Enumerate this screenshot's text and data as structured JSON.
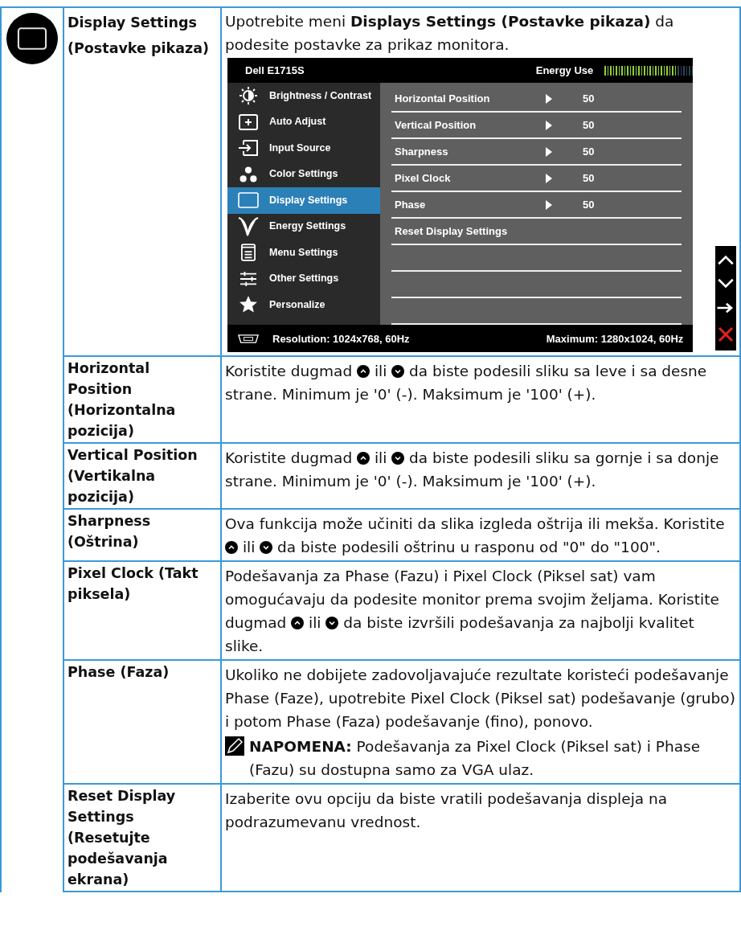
{
  "section": {
    "title": "Display Settings (Postavke pikaza)",
    "intro": "Upotrebite meni **Displays Settings (Postavke pikaza)** da podesite postavke za prikaz monitora."
  },
  "osd": {
    "model": "Dell E1715S",
    "energy_label": "Energy Use",
    "energy": {
      "level": 0.8
    },
    "menu": [
      {
        "kind": "brightness",
        "label": "Brightness / Contrast",
        "selected": false
      },
      {
        "kind": "auto",
        "label": "Auto Adjust",
        "selected": false
      },
      {
        "kind": "input",
        "label": "Input Source",
        "selected": false
      },
      {
        "kind": "color",
        "label": "Color Settings",
        "selected": false
      },
      {
        "kind": "display",
        "label": "Display Settings",
        "selected": true
      },
      {
        "kind": "energy",
        "label": "Energy Settings",
        "selected": false
      },
      {
        "kind": "menu",
        "label": "Menu Settings",
        "selected": false
      },
      {
        "kind": "other",
        "label": "Other Settings",
        "selected": false
      },
      {
        "kind": "personalize",
        "label": "Personalize",
        "selected": false
      }
    ],
    "submenu": [
      {
        "label": "Horizontal Position",
        "value": "50"
      },
      {
        "label": "Vertical Position",
        "value": "50"
      },
      {
        "label": "Sharpness",
        "value": "50"
      },
      {
        "label": "Pixel Clock",
        "value": "50"
      },
      {
        "label": "Phase",
        "value": "50"
      },
      {
        "label": "Reset Display Settings"
      }
    ],
    "resolution": "Resolution: 1024x768, 60Hz",
    "maximum": "Maximum: 1280x1024, 60Hz",
    "buttons": [
      {
        "kind": "up"
      },
      {
        "kind": "down"
      },
      {
        "kind": "enter"
      },
      {
        "kind": "exit"
      }
    ]
  },
  "rows": [
    {
      "label": "Horizontal Position (Horizontalna pozicija)",
      "parts": [
        {
          "kind": "text",
          "text": "Koristite dugmad "
        },
        {
          "kind": "up"
        },
        {
          "kind": "text",
          "text": " ili "
        },
        {
          "kind": "down"
        },
        {
          "kind": "text",
          "text": " da biste podesili sliku sa leve i sa desne strane. Minimum je '0' (-). Maksimum je '100' (+)."
        }
      ]
    },
    {
      "label": "Vertical Position (Vertikalna pozicija)",
      "parts": [
        {
          "kind": "text",
          "text": "Koristite dugmad "
        },
        {
          "kind": "up"
        },
        {
          "kind": "text",
          "text": " ili "
        },
        {
          "kind": "down"
        },
        {
          "kind": "text",
          "text": " da biste podesili sliku sa gornje i sa donje strane. Minimum je '0' (-). Maksimum je '100' (+)."
        }
      ]
    },
    {
      "label": "Sharpness (Oštrina)",
      "parts": [
        {
          "kind": "text",
          "text": "Ova funkcija može učiniti da slika izgleda oštrija ili mekša. Koristite "
        },
        {
          "kind": "up"
        },
        {
          "kind": "text",
          "text": " ili "
        },
        {
          "kind": "down"
        },
        {
          "kind": "text",
          "text": " da biste podesili oštrinu u rasponu od \"0\" do \"100\"."
        }
      ]
    },
    {
      "label": "Pixel Clock (Takt piksela)",
      "parts": [
        {
          "kind": "text",
          "text": "Podešavanja za Phase (Fazu) i Pixel Clock (Piksel sat) vam omogućavaju da podesite monitor prema svojim željama. Koristite dugmad "
        },
        {
          "kind": "up"
        },
        {
          "kind": "text",
          "text": " ili "
        },
        {
          "kind": "down"
        },
        {
          "kind": "text",
          "text": " da biste izvršili podešavanja za najbolji kvalitet slike."
        }
      ]
    },
    {
      "label": "Phase (Faza)",
      "parts": [
        {
          "kind": "text",
          "text": "Ukoliko ne dobijete zadovoljavajuće rezultate koristeći podešavanje Phase (Faze), upotrebite Pixel Clock (Piksel sat) podešavanje (grubo) i potom Phase (Faza) podešavanje (fino), ponovo."
        }
      ],
      "note": "**NAPOMENA:** Podešavanja za Pixel Clock (Piksel sat) i Phase (Fazu) su dostupna samo za VGA ulaz."
    },
    {
      "label": "Reset Display Settings (Resetujte podešavanja ekrana)",
      "parts": [
        {
          "kind": "text",
          "text": "Izaberite ovu opciju da biste vratili podešavanja displeja na podrazumevanu vrednost."
        }
      ]
    }
  ]
}
